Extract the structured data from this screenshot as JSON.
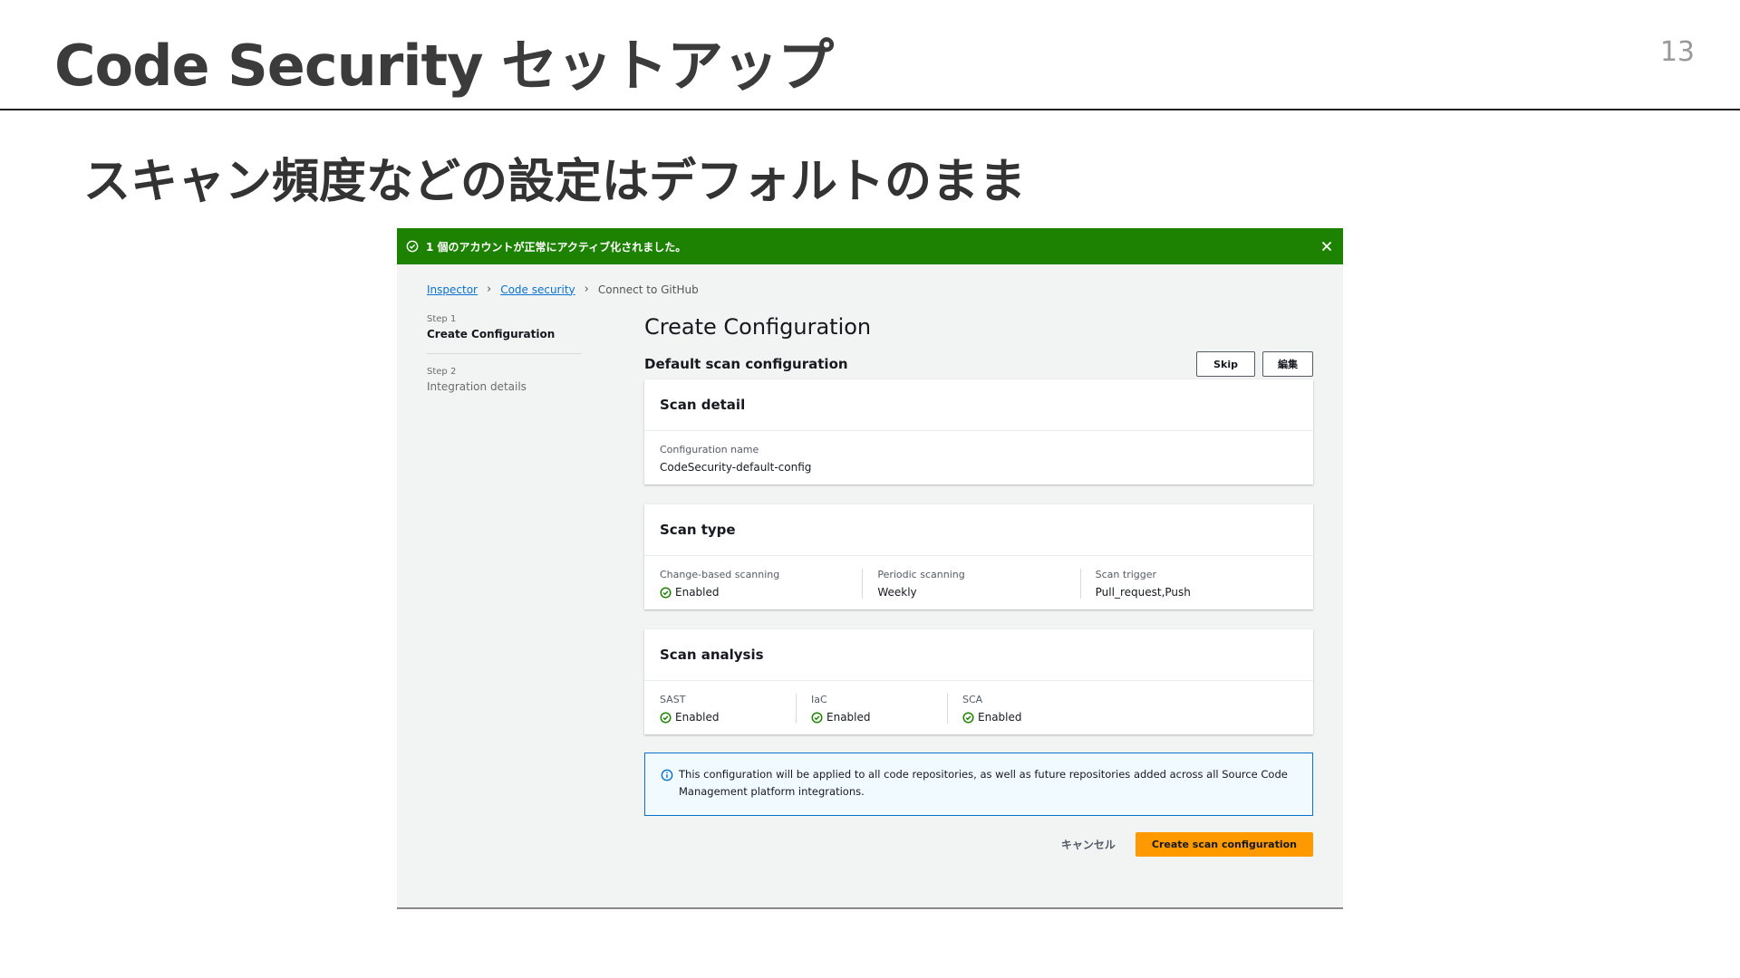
{
  "slide": {
    "title": "Code Security セットアップ",
    "page_number": "13",
    "subtitle": "スキャン頻度などの設定はデフォルトのまま"
  },
  "flash": {
    "message": "1 個のアカウントが正常にアクティブ化されました。",
    "color": "#1d8102"
  },
  "breadcrumb": {
    "items": [
      "Inspector",
      "Code security"
    ],
    "current": "Connect to GitHub"
  },
  "steps": [
    {
      "label": "Step 1",
      "title": "Create Configuration"
    },
    {
      "label": "Step 2",
      "title": "Integration details"
    }
  ],
  "main": {
    "heading": "Create Configuration",
    "section_label": "Default scan configuration",
    "skip_label": "Skip",
    "edit_label": "編集",
    "scan_detail": {
      "title": "Scan detail",
      "config_name_key": "Configuration name",
      "config_name_value": "CodeSecurity-default-config"
    },
    "scan_type": {
      "title": "Scan type",
      "columns": [
        {
          "key": "Change-based scanning",
          "value": "Enabled",
          "status": "enabled"
        },
        {
          "key": "Periodic scanning",
          "value": "Weekly",
          "status": "none"
        },
        {
          "key": "Scan trigger",
          "value": "Pull_request,Push",
          "status": "none"
        }
      ]
    },
    "scan_analysis": {
      "title": "Scan analysis",
      "columns": [
        {
          "key": "SAST",
          "value": "Enabled"
        },
        {
          "key": "IaC",
          "value": "Enabled"
        },
        {
          "key": "SCA",
          "value": "Enabled"
        }
      ]
    },
    "info_text": "This configuration will be applied to all code repositories, as well as future repositories added across all Source Code Management platform integrations.",
    "cancel_label": "キャンセル",
    "create_label": "Create scan configuration",
    "primary_color": "#ff9900"
  }
}
